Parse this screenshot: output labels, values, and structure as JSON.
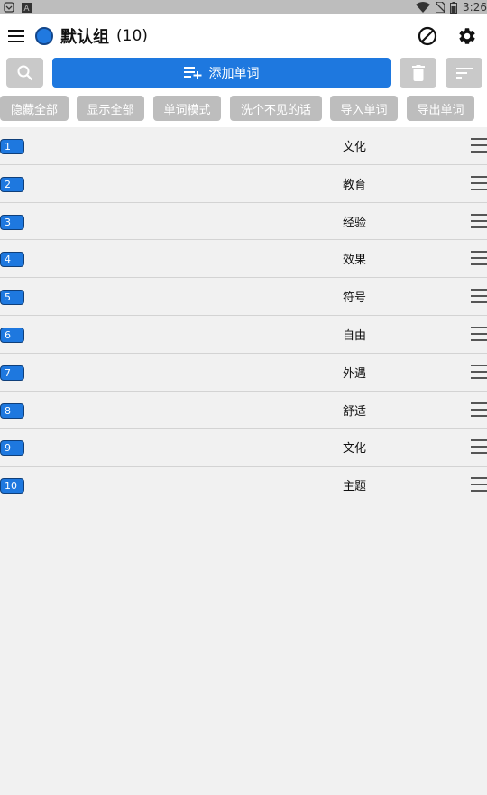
{
  "status_bar": {
    "time": "3:26",
    "icons": [
      "notification-icon",
      "a-icon",
      "wifi-icon",
      "no-sim-icon",
      "battery-icon"
    ]
  },
  "app_bar": {
    "title": "默认组",
    "count": "(10)",
    "group_color": "#2079e0"
  },
  "toolbar": {
    "add_label": "添加单词",
    "accent_color": "#1e78df"
  },
  "chips": [
    "隐藏全部",
    "显示全部",
    "单词模式",
    "洗个不见的话",
    "导入单词",
    "导出单词"
  ],
  "words": [
    {
      "num": "1",
      "word": "文化"
    },
    {
      "num": "2",
      "word": "教育"
    },
    {
      "num": "3",
      "word": "经验"
    },
    {
      "num": "4",
      "word": "效果"
    },
    {
      "num": "5",
      "word": "符号"
    },
    {
      "num": "6",
      "word": "自由"
    },
    {
      "num": "7",
      "word": "外遇"
    },
    {
      "num": "8",
      "word": "舒适"
    },
    {
      "num": "9",
      "word": "文化"
    },
    {
      "num": "10",
      "word": "主题"
    }
  ]
}
